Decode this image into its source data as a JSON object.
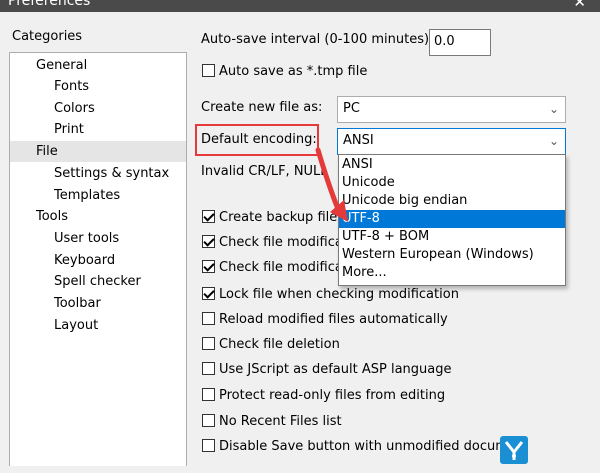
{
  "window": {
    "title": "Preferences",
    "close_glyph": "✕"
  },
  "categories": {
    "label": "Categories",
    "items": [
      {
        "label": "General",
        "level": 0
      },
      {
        "label": "Fonts",
        "level": 1
      },
      {
        "label": "Colors",
        "level": 1
      },
      {
        "label": "Print",
        "level": 1
      },
      {
        "label": "File",
        "level": 0,
        "selected": true
      },
      {
        "label": "Settings & syntax",
        "level": 1
      },
      {
        "label": "Templates",
        "level": 1
      },
      {
        "label": "Tools",
        "level": 0
      },
      {
        "label": "User tools",
        "level": 1
      },
      {
        "label": "Keyboard",
        "level": 1
      },
      {
        "label": "Spell checker",
        "level": 1
      },
      {
        "label": "Toolbar",
        "level": 1
      },
      {
        "label": "Layout",
        "level": 1
      }
    ]
  },
  "file_settings": {
    "autosave_interval_label": "Auto-save interval (0-100 minutes):",
    "autosave_interval_value": "0.0",
    "autosave_tmp_label": "Auto save as *.tmp file",
    "autosave_tmp_checked": false,
    "new_file_as_label": "Create new file as:",
    "new_file_as_value": "PC",
    "default_encoding_label": "Default encoding:",
    "default_encoding_value": "ANSI",
    "invalid_crlf_label": "Invalid CR/LF, NULL",
    "dropdown_icon": "chevron-down-icon",
    "checkboxes": [
      {
        "label": "Create backup file",
        "checked": true
      },
      {
        "label": "Check file modifica",
        "checked": true
      },
      {
        "label": "Check file modifica",
        "checked": true
      },
      {
        "label": "Lock file when checking modification",
        "checked": true
      },
      {
        "label": "Reload modified files automatically",
        "checked": false
      },
      {
        "label": "Check file deletion",
        "checked": false
      },
      {
        "label": "Use JScript as default ASP language",
        "checked": false
      },
      {
        "label": "Protect read-only files from editing",
        "checked": false
      },
      {
        "label": "No Recent Files list",
        "checked": false
      },
      {
        "label": "Disable Save button with unmodified docume",
        "checked": false
      }
    ]
  },
  "encoding_dropdown": {
    "options": [
      "ANSI",
      "Unicode",
      "Unicode big endian",
      "UTF-8",
      "UTF-8 + BOM",
      "Western European (Windows)",
      "More..."
    ],
    "highlighted": "UTF-8"
  },
  "colors": {
    "accent": "#0078d7",
    "annotation_red": "#e43a3a"
  }
}
